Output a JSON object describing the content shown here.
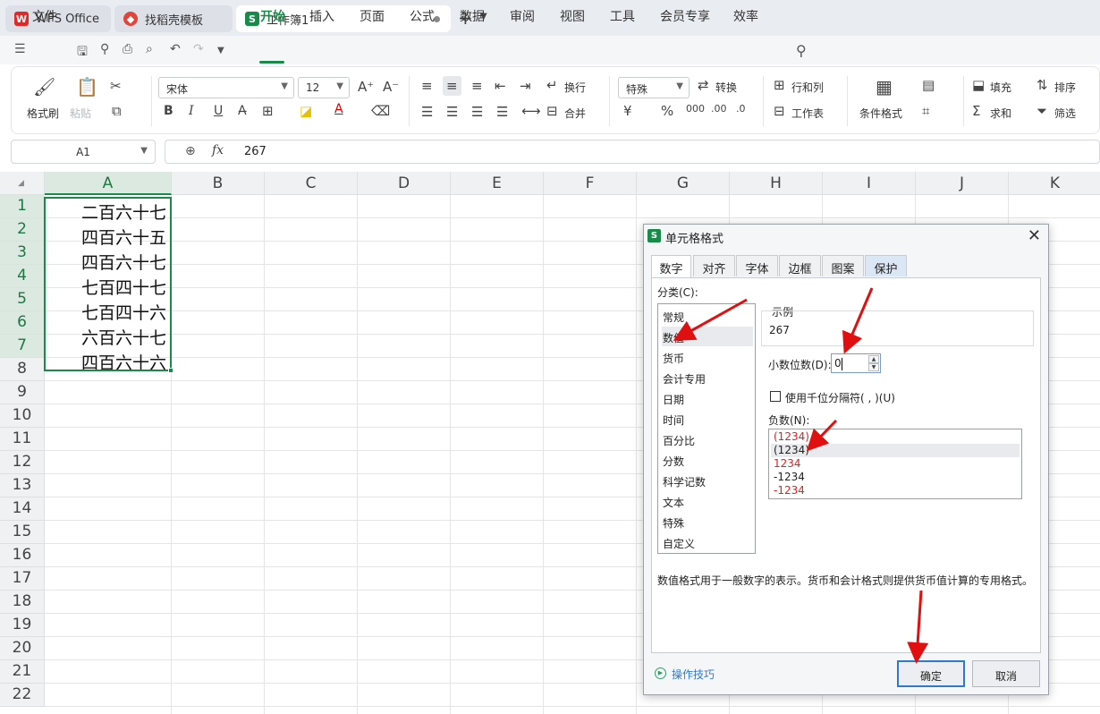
{
  "tabs": [
    {
      "label": "WPS Office"
    },
    {
      "label": "找稻壳模板"
    },
    {
      "label": "工作簿1"
    }
  ],
  "menu": {
    "file": "文件",
    "items": [
      "开始",
      "插入",
      "页面",
      "公式",
      "数据",
      "审阅",
      "视图",
      "工具",
      "会员专享",
      "效率"
    ]
  },
  "ribbon": {
    "format_painter": "格式刷",
    "paste": "粘贴",
    "font_name": "宋体",
    "font_size": "12",
    "wrap": "换行",
    "merge": "合并",
    "number_format": "特殊",
    "convert": "转换",
    "rows_cols": "行和列",
    "worksheet": "工作表",
    "cond_format": "条件格式",
    "fill": "填充",
    "sort": "排序",
    "sum": "求和",
    "filter": "筛选"
  },
  "formula_bar": {
    "cell_ref": "A1",
    "fx": "fx",
    "value": "267"
  },
  "grid": {
    "columns": [
      "A",
      "B",
      "C",
      "D",
      "E",
      "F",
      "G",
      "H",
      "I",
      "J",
      "K"
    ],
    "rows": [
      "1",
      "2",
      "3",
      "4",
      "5",
      "6",
      "7",
      "8",
      "9",
      "10",
      "11",
      "12",
      "13",
      "14",
      "15",
      "16",
      "17",
      "18",
      "19",
      "20",
      "21",
      "22"
    ],
    "column_a_values": [
      "二百六十七",
      "四百六十五",
      "四百六十七",
      "七百四十七",
      "七百四十六",
      "六百六十七",
      "四百六十六"
    ]
  },
  "dialog": {
    "title": "单元格格式",
    "tabs": [
      "数字",
      "对齐",
      "字体",
      "边框",
      "图案",
      "保护"
    ],
    "category_label": "分类(C):",
    "categories": [
      "常规",
      "数值",
      "货币",
      "会计专用",
      "日期",
      "时间",
      "百分比",
      "分数",
      "科学记数",
      "文本",
      "特殊",
      "自定义"
    ],
    "selected_category": "数值",
    "sample_label": "示例",
    "sample_value": "267",
    "decimal_label": "小数位数(D):",
    "decimal_value": "0",
    "thousand_sep_label": "使用千位分隔符( , )(U)",
    "negative_label": "负数(N):",
    "negative_options": [
      "(1234)",
      "(1234)",
      "1234",
      "-1234",
      "-1234"
    ],
    "description": "数值格式用于一般数字的表示。货币和会计格式则提供货币值计算的专用格式。",
    "tips": "操作技巧",
    "ok": "确定",
    "cancel": "取消"
  },
  "colors": {
    "accent": "#1a8a4a",
    "negative_red": "#d22222",
    "annotation_arrow": "#e01010"
  }
}
